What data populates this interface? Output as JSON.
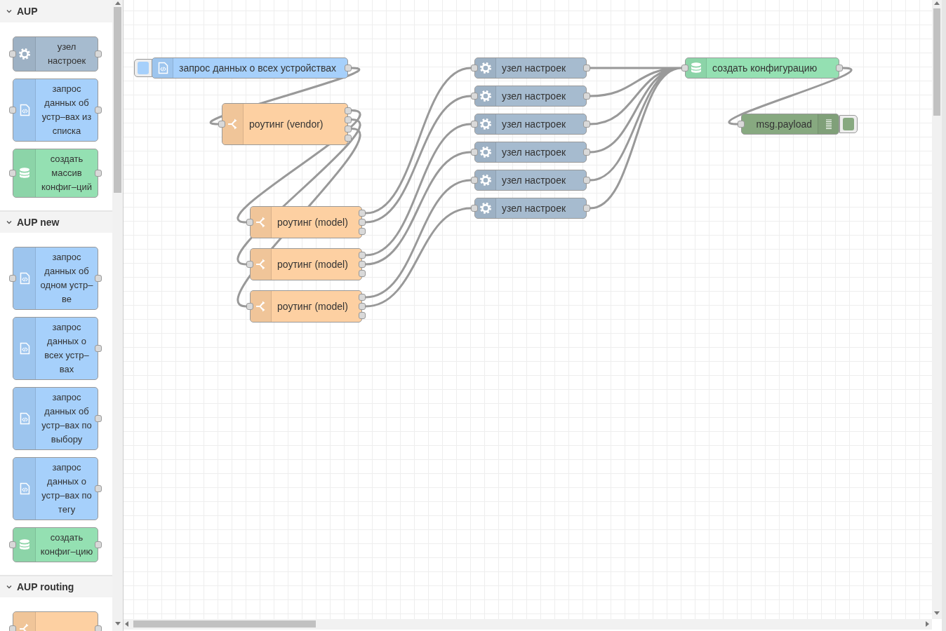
{
  "palette": {
    "categories": [
      {
        "name": "AUP",
        "expanded": true,
        "nodes": [
          {
            "kind": "config",
            "label": "узел настроек",
            "input": true
          },
          {
            "kind": "request",
            "label": "запрос данных об устр–вах из списка",
            "input": true
          },
          {
            "kind": "db",
            "label": "создать массив конфиг–ций",
            "input": true
          }
        ]
      },
      {
        "name": "AUP new",
        "expanded": true,
        "nodes": [
          {
            "kind": "request",
            "label": "запрос данных об одном устр–ве",
            "input": true
          },
          {
            "kind": "request",
            "label": "запрос данных о всех устр–вах",
            "input": false
          },
          {
            "kind": "request",
            "label": "запрос данных об устр–вах по выбору",
            "input": false
          },
          {
            "kind": "request",
            "label": "запрос данных о устр–вах по тегу",
            "input": false
          },
          {
            "kind": "db",
            "label": "создать конфиг–цию",
            "input": true
          }
        ]
      },
      {
        "name": "AUP routing",
        "expanded": true,
        "nodes": [
          {
            "kind": "switch",
            "input": true
          }
        ]
      }
    ]
  },
  "flow": {
    "nodes": [
      {
        "kind": "inject",
        "label": "запрос данных о всех устройствах"
      },
      {
        "kind": "switch",
        "label": "роутинг (vendor)"
      },
      {
        "kind": "switch",
        "label": "роутинг (model)"
      },
      {
        "kind": "switch",
        "label": "роутинг (model)"
      },
      {
        "kind": "switch",
        "label": "роутинг (model)"
      },
      {
        "kind": "config",
        "label": "узел настроек"
      },
      {
        "kind": "config",
        "label": "узел настроек"
      },
      {
        "kind": "config",
        "label": "узел настроек"
      },
      {
        "kind": "config",
        "label": "узел настроек"
      },
      {
        "kind": "config",
        "label": "узел настроек"
      },
      {
        "kind": "config",
        "label": "узел настроек"
      },
      {
        "kind": "db",
        "label": "создать конфигурацию"
      },
      {
        "kind": "debug",
        "label": "msg.payload"
      }
    ]
  }
}
